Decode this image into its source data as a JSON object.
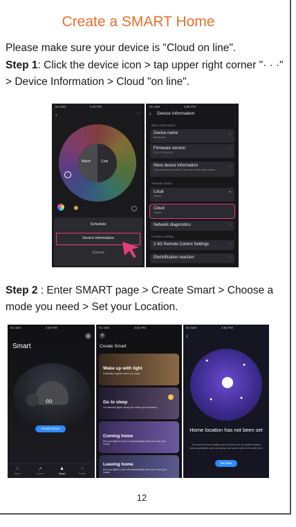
{
  "title": "Create a SMART Home",
  "intro": "Please make sure your device is \"Cloud on line\".",
  "step1": {
    "label": "Step 1",
    "text": ": Click the device icon > tap upper right corner \"· · ·\" > Device Information > Cloud \"on line\"."
  },
  "step2": {
    "label": "Step 2",
    "text": " : Enter SMART page > Create Smart > Choose a mode you need > Set your Location."
  },
  "phone1": {
    "status_time": "5:40 PM",
    "status_carrier": "No SIM",
    "warm_label": "Warm",
    "cool_label": "Cool",
    "menu": [
      "Schedule",
      "Device Information",
      "Cancel"
    ]
  },
  "phone2": {
    "status_time": "6:56 PM",
    "status_carrier": "No SIM",
    "header": "Device Information",
    "sections": [
      "Basic information",
      "Network status",
      "Function setting"
    ],
    "rows": [
      {
        "title": "Device name",
        "sub": "Bluetooth"
      },
      {
        "title": "Firmware version",
        "sub": "V1.0.0 V2.0.0 A"
      },
      {
        "title": "More device information",
        "sub": "View device's virtual ID, mac and other information"
      },
      {
        "title": "Local",
        "sub": "Online"
      },
      {
        "title": "Cloud",
        "sub": "Online"
      },
      {
        "title": "Network diagnostics",
        "sub": ""
      },
      {
        "title": "2.4G Remote Control Settings",
        "sub": ""
      },
      {
        "title": "Electrification reaction",
        "sub": ""
      }
    ]
  },
  "phone3": {
    "status_time": "4:50 PM",
    "status_carrier": "No SIM",
    "title": "Smart",
    "button": "Create Smart",
    "tabs": [
      "Home",
      "Scene",
      "Smart",
      "Profile"
    ]
  },
  "phone4": {
    "status_time": "3:53 PM",
    "status_carrier": "No SIM",
    "title": "Create Smart",
    "cards": [
      {
        "title": "Wake up with light",
        "sub": "Gradually brighten when you wake"
      },
      {
        "title": "Go to sleep",
        "sub": "Let selected lights slowly dim when you fall asleep"
      },
      {
        "title": "Coming home",
        "sub": "Set your lights to turn on automatically when you near your house"
      },
      {
        "title": "Leaving home",
        "sub": "Set your lights to turn off automatically when you leave your house"
      }
    ]
  },
  "phone5": {
    "status_time": "3:53 PM",
    "status_carrier": "No SIM",
    "heading": "Home location has not been set",
    "body": "The current home location has not been set, so location based smart operations such as sunrise and sunset will not be able to be",
    "button": "Set Now"
  },
  "page_number": "12",
  "colors": {
    "title": "#e8702a",
    "highlight": "#e0407a",
    "button": "#2f8cff"
  }
}
